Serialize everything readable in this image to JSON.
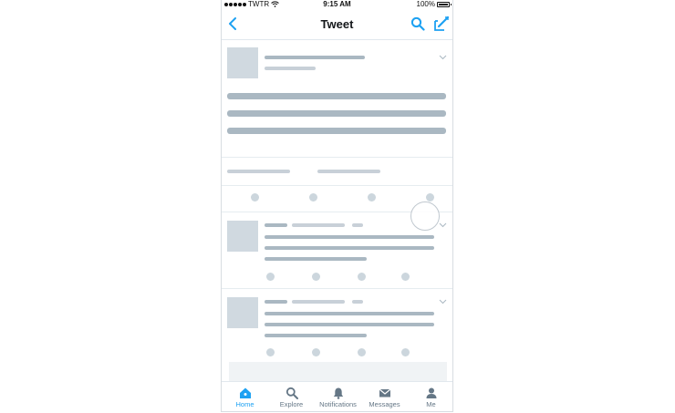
{
  "status_bar": {
    "carrier": "TWTR",
    "time": "9:15 AM",
    "battery": "100%"
  },
  "nav": {
    "title": "Tweet",
    "back_icon": "chevron-left-icon",
    "search_icon": "search-icon",
    "compose_icon": "compose-icon"
  },
  "tabs": [
    {
      "label": "Home",
      "icon": "home-icon",
      "active": true
    },
    {
      "label": "Explore",
      "icon": "search-icon",
      "active": false
    },
    {
      "label": "Notifications",
      "icon": "bell-icon",
      "active": false
    },
    {
      "label": "Messages",
      "icon": "envelope-icon",
      "active": false
    },
    {
      "label": "Me",
      "icon": "person-icon",
      "active": false
    }
  ],
  "colors": {
    "accent": "#1da1f2",
    "placeholder": "#c8d0d8",
    "placeholder_dark": "#aab8c2"
  }
}
